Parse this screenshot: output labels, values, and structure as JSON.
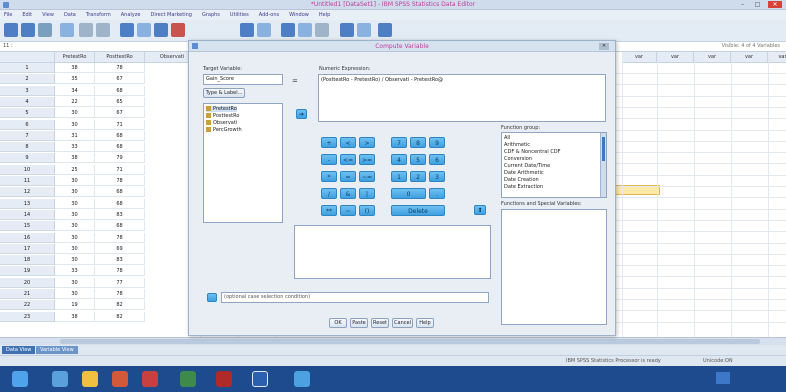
{
  "window": {
    "title": "*Untitled1 [DataSet1] - IBM SPSS Statistics Data Editor"
  },
  "menubar": [
    "File",
    "Edit",
    "View",
    "Data",
    "Transform",
    "Analyze",
    "Direct Marketing",
    "Graphs",
    "Utilities",
    "Add-ons",
    "Window",
    "Help"
  ],
  "refbar": {
    "cell": "11 :",
    "visible": "Visible: 4 of 4 Variables"
  },
  "grid": {
    "columns": [
      "PretestRo",
      "PosttestRo",
      "Observati",
      "var",
      "var",
      "var",
      "var",
      "var",
      "var",
      "var",
      "var"
    ],
    "rows": [
      [
        "1",
        "38",
        "78"
      ],
      [
        "2",
        "35",
        "67"
      ],
      [
        "3",
        "34",
        "68"
      ],
      [
        "4",
        "22",
        "65"
      ],
      [
        "5",
        "30",
        "67"
      ],
      [
        "6",
        "30",
        "71"
      ],
      [
        "7",
        "31",
        "68"
      ],
      [
        "8",
        "33",
        "68"
      ],
      [
        "9",
        "38",
        "79"
      ],
      [
        "10",
        "25",
        "71"
      ],
      [
        "11",
        "30",
        "78"
      ],
      [
        "12",
        "30",
        "68"
      ],
      [
        "13",
        "30",
        "68"
      ],
      [
        "14",
        "30",
        "83"
      ],
      [
        "15",
        "30",
        "68"
      ],
      [
        "16",
        "30",
        "78"
      ],
      [
        "17",
        "30",
        "69"
      ],
      [
        "18",
        "30",
        "83"
      ],
      [
        "19",
        "33",
        "78"
      ],
      [
        "20",
        "30",
        "77"
      ],
      [
        "21",
        "30",
        "78"
      ],
      [
        "22",
        "19",
        "82"
      ],
      [
        "23",
        "38",
        "82"
      ]
    ]
  },
  "tabs": [
    "Data View",
    "Variable View"
  ],
  "status": {
    "processor": "IBM SPSS Statistics Processor is ready",
    "unicode": "Unicode:ON"
  },
  "dialog": {
    "title": "Compute Variable",
    "target_label": "Target Variable:",
    "target_value": "Gain_Score",
    "type_label_button": "Type & Label...",
    "variables": [
      "PretestRo",
      "PosttestRo",
      "Observati",
      "PercGrowth"
    ],
    "numexp_label": "Numeric Expression:",
    "numexp_value": "(PosttestRo - PretestRo) / Observati - PretestRo@",
    "keypad": [
      [
        "+",
        "<",
        ">",
        "7",
        "8",
        "9"
      ],
      [
        "-",
        "<=",
        ">=",
        "4",
        "5",
        "6"
      ],
      [
        "*",
        "=",
        "~=",
        "1",
        "2",
        "3"
      ],
      [
        "/",
        "&",
        "|",
        "0",
        "."
      ],
      [
        "**",
        "~",
        "()",
        "Delete"
      ]
    ],
    "funcgroup_label": "Function group:",
    "funcgroups": [
      "All",
      "Arithmetic",
      "CDF & Noncentral CDF",
      "Conversion",
      "Current Date/Time",
      "Date Arithmetic",
      "Date Creation",
      "Date Extraction"
    ],
    "funcs_label": "Functions and Special Variables:",
    "if_text": "(optional case selection condition)",
    "buttons": [
      "OK",
      "Paste",
      "Reset",
      "Cancel",
      "Help"
    ]
  },
  "colors": {
    "accent": "#3f71b3",
    "title_text": "#bf3b9b",
    "taskbar": "#1e4a8e",
    "keypad": "#4fb0e8"
  }
}
